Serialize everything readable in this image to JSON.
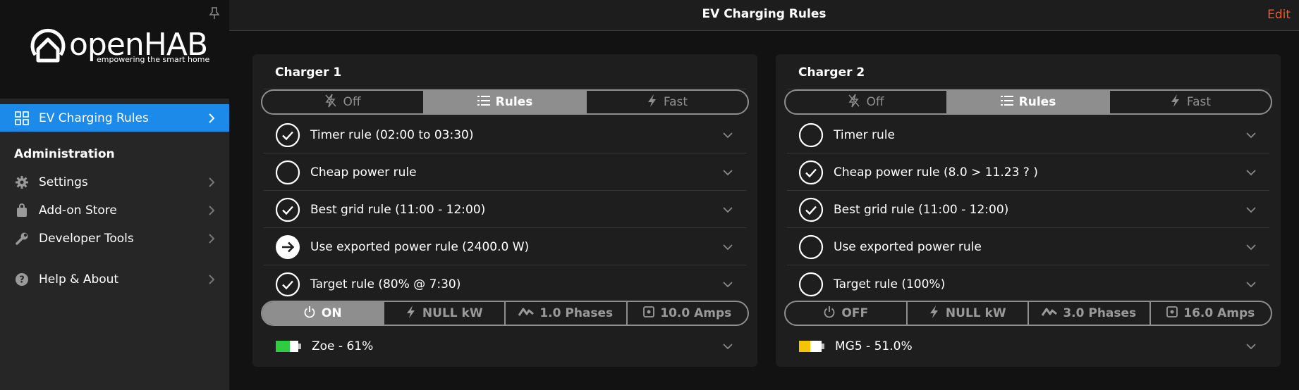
{
  "sidebar": {
    "logo_text": "openHAB",
    "logo_tagline": "empowering the smart home",
    "active_item": "EV Charging Rules",
    "section_title": "Administration",
    "items": [
      {
        "label": "Settings"
      },
      {
        "label": "Add-on Store"
      },
      {
        "label": "Developer Tools"
      },
      {
        "label": "Help & About"
      }
    ]
  },
  "header": {
    "title": "EV Charging Rules",
    "edit_label": "Edit"
  },
  "colors": {
    "accent": "#1b8ae8",
    "edit": "#ef5b2b",
    "battery_green": "#2ecc40",
    "battery_yellow": "#f5c400"
  },
  "chargers": [
    {
      "title": "Charger 1",
      "modes": [
        {
          "label": "Off",
          "icon": "flash-off-icon"
        },
        {
          "label": "Rules",
          "icon": "list-icon",
          "active": true
        },
        {
          "label": "Fast",
          "icon": "flash-icon"
        }
      ],
      "rules": [
        {
          "label": "Timer rule (02:00 to 03:30)",
          "status": "check"
        },
        {
          "label": "Cheap power rule",
          "status": "empty"
        },
        {
          "label": "Best grid rule (11:00 - 12:00)",
          "status": "check"
        },
        {
          "label": "Use exported power rule (2400.0 W)",
          "status": "arrow"
        },
        {
          "label": "Target rule (80% @ 7:30)",
          "status": "check"
        }
      ],
      "status_bar": [
        {
          "label": "ON",
          "icon": "power-icon",
          "active": true
        },
        {
          "label": "NULL kW",
          "icon": "flash-icon"
        },
        {
          "label": "1.0 Phases",
          "icon": "wave-icon"
        },
        {
          "label": "10.0 Amps",
          "icon": "square-dot-icon"
        }
      ],
      "battery": {
        "label": "Zoe - 61%",
        "level": 0.61,
        "color": "#2ecc40"
      }
    },
    {
      "title": "Charger 2",
      "modes": [
        {
          "label": "Off",
          "icon": "flash-off-icon"
        },
        {
          "label": "Rules",
          "icon": "list-icon",
          "active": true
        },
        {
          "label": "Fast",
          "icon": "flash-icon"
        }
      ],
      "rules": [
        {
          "label": "Timer rule",
          "status": "empty"
        },
        {
          "label": "Cheap power rule (8.0 > 11.23 ? )",
          "status": "check"
        },
        {
          "label": "Best grid rule (11:00 - 12:00)",
          "status": "check"
        },
        {
          "label": "Use exported power rule",
          "status": "empty"
        },
        {
          "label": "Target rule (100%)",
          "status": "empty"
        }
      ],
      "status_bar": [
        {
          "label": "OFF",
          "icon": "power-icon",
          "active": false
        },
        {
          "label": "NULL kW",
          "icon": "flash-icon"
        },
        {
          "label": "3.0 Phases",
          "icon": "wave-icon"
        },
        {
          "label": "16.0 Amps",
          "icon": "square-dot-icon"
        }
      ],
      "battery": {
        "label": "MG5 - 51.0%",
        "level": 0.51,
        "color": "#f5c400"
      }
    }
  ]
}
